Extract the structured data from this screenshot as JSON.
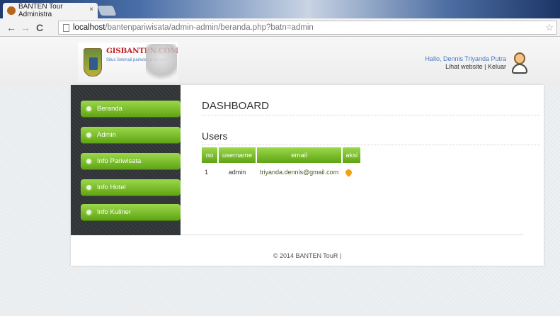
{
  "browser": {
    "tab_title": "BANTEN Tour Administra",
    "tab_close": "×",
    "url_host": "localhost",
    "url_path": "/bantenpariwisata/admin-admin/beranda.php?batn=admin",
    "back_glyph": "←",
    "forward_glyph": "→",
    "reload_glyph": "C",
    "star_glyph": "☆"
  },
  "header": {
    "logo_text": "GISBANTEN.COM",
    "logo_tagline": "Situs Sekmail pariwisata Banten",
    "greeting": "Hallo, Dennis Triyanda Putra",
    "view_site": "Lihat website",
    "separator": "|",
    "logout": "Keluar"
  },
  "sidebar": {
    "items": [
      {
        "label": "Beranda"
      },
      {
        "label": "Admin"
      },
      {
        "label": "Info Pariwisata"
      },
      {
        "label": "Info Hotel"
      },
      {
        "label": "Info Kuliner"
      }
    ]
  },
  "main": {
    "title": "DASHBOARD",
    "section": "Users",
    "table": {
      "headers": [
        "no",
        "username",
        "email",
        "aksi"
      ],
      "rows": [
        {
          "no": "1",
          "username": "admin",
          "email": "triyanda.dennis@gmail.com"
        }
      ]
    }
  },
  "footer": {
    "text": "© 2014 BANTEN TouR |"
  },
  "colors": {
    "menu_green": "#7cc22e",
    "link_blue": "#4a78c2",
    "logo_red": "#c0242b",
    "sidebar_dark": "#333739"
  },
  "icons": [
    "favicon-icon",
    "page-icon",
    "star-icon",
    "avatar-icon",
    "edit-icon",
    "bullet-icon"
  ]
}
